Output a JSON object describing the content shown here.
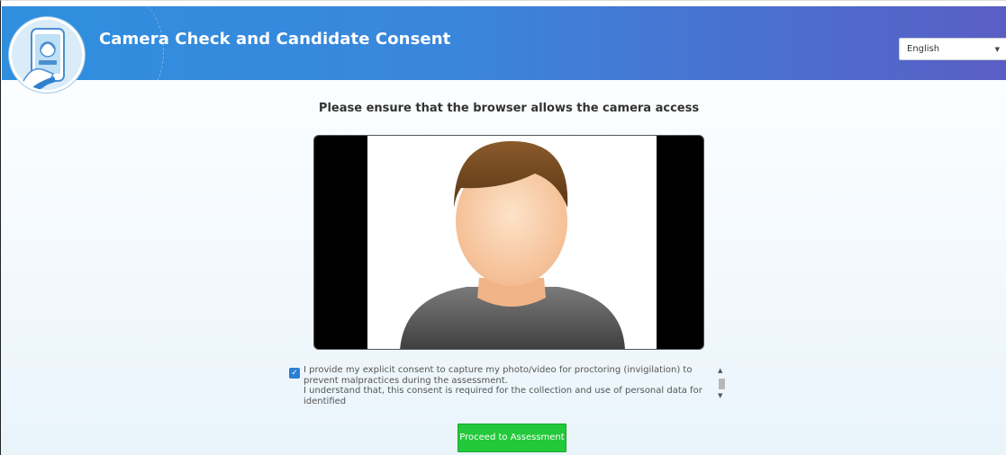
{
  "header": {
    "title": "Camera Check and Candidate Consent",
    "language": {
      "selected": "English"
    }
  },
  "main": {
    "instruction": "Please ensure that the browser allows the camera access",
    "consent": {
      "checked": true,
      "line1": "I provide my explicit consent to capture my photo/video for proctoring (invigilation) to prevent malpractices during the assessment.",
      "line2": "I understand that, this consent is required for the collection and use of personal data for identified"
    },
    "proceed_label": "Proceed to Assessment"
  },
  "colors": {
    "header_start": "#2f8fde",
    "header_end": "#5a5ec4",
    "proceed_button": "#22c93a",
    "checkbox": "#2a7fd4"
  },
  "icons": {
    "logo": "phone-selfie-icon",
    "avatar": "person-placeholder-icon"
  }
}
